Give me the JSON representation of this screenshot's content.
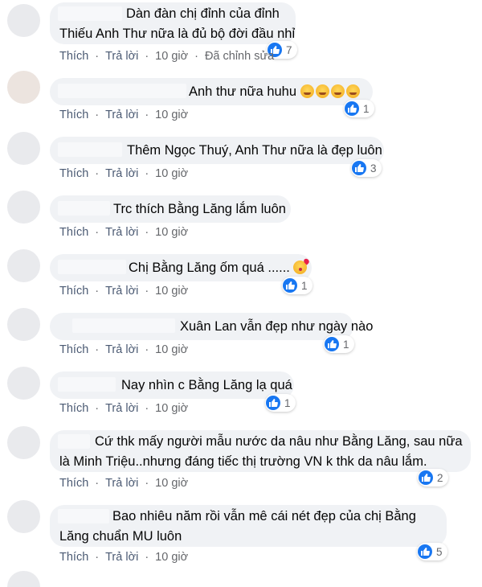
{
  "comments": [
    {
      "line1": "Dàn đàn chị đỉnh của đỉnh",
      "line2": "Thiếu Anh Thư nữa là đủ bộ đời đầu nhỉ",
      "likes": "7",
      "like_label": "Thích",
      "reply_label": "Trả lời",
      "time": "10 giờ",
      "edited": "Đã chỉnh sửa"
    },
    {
      "line1": "Anh thư nữa huhu",
      "likes": "1",
      "like_label": "Thích",
      "reply_label": "Trả lời",
      "time": "10 giờ"
    },
    {
      "line1": "Thêm Ngọc Thuý, Anh Thư nữa là đẹp luôn",
      "likes": "3",
      "like_label": "Thích",
      "reply_label": "Trả lời",
      "time": "10 giờ"
    },
    {
      "line1": "Trc thích Bằng Lăng lắm luôn",
      "like_label": "Thích",
      "reply_label": "Trả lời",
      "time": "10 giờ"
    },
    {
      "line1": "Chị Bằng Lăng ốm quá ......",
      "likes": "1",
      "like_label": "Thích",
      "reply_label": "Trả lời",
      "time": "10 giờ"
    },
    {
      "line1": "Xuân Lan vẫn đẹp như ngày nào",
      "likes": "1",
      "like_label": "Thích",
      "reply_label": "Trả lời",
      "time": "10 giờ"
    },
    {
      "line1": "Nay nhìn c Bằng Lăng lạ quá",
      "likes": "1",
      "like_label": "Thích",
      "reply_label": "Trả lời",
      "time": "10 giờ"
    },
    {
      "line1": "Cứ thk mấy người mẫu nước da nâu như Bằng Lăng, sau nữa",
      "line2": "là Minh Triệu..nhưng đáng tiếc thị trường VN k thk da nâu lắm.",
      "likes": "2",
      "like_label": "Thích",
      "reply_label": "Trả lời",
      "time": "10 giờ"
    },
    {
      "line1": "Bao nhiêu năm rồi vẫn mê cái nét đẹp của chị Bằng",
      "line2": "Lăng chuẩn MU luôn",
      "likes": "5",
      "like_label": "Thích",
      "reply_label": "Trả lời",
      "time": "10 giờ"
    }
  ],
  "colors": {
    "bubble": "#f0f2f5",
    "like_blue": "#1877f2",
    "meta_text": "#65676b"
  },
  "icons": {
    "reaction": "like-icon",
    "emoji_comment2": "weary-face-icon",
    "emoji_comment5": "kissing-face-icon"
  }
}
